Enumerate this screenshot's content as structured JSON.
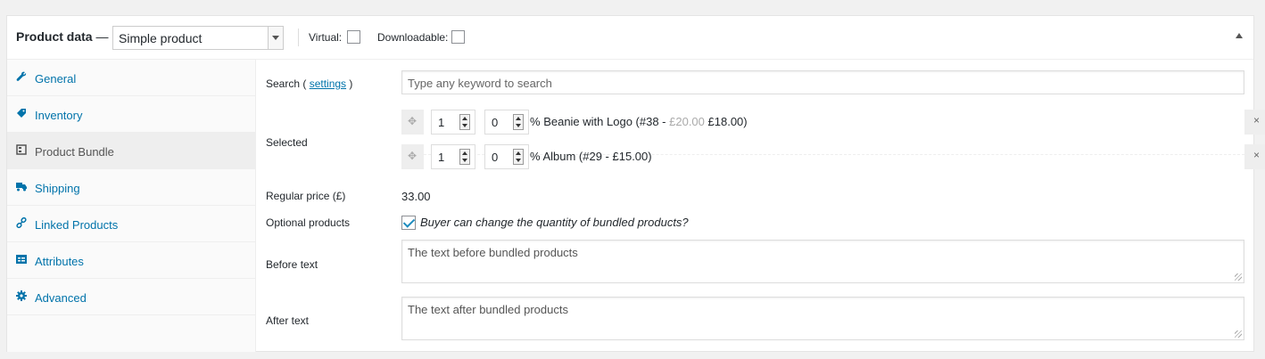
{
  "header": {
    "title": "Product data",
    "dash": "—",
    "product_type": "Simple product",
    "virtual_label": "Virtual:",
    "downloadable_label": "Downloadable:"
  },
  "tabs": [
    {
      "label": "General",
      "icon": "wrench-icon"
    },
    {
      "label": "Inventory",
      "icon": "tag-icon"
    },
    {
      "label": "Product Bundle",
      "icon": "bundle-icon",
      "active": true
    },
    {
      "label": "Shipping",
      "icon": "truck-icon"
    },
    {
      "label": "Linked Products",
      "icon": "link-icon"
    },
    {
      "label": "Attributes",
      "icon": "attributes-icon"
    },
    {
      "label": "Advanced",
      "icon": "gear-icon"
    }
  ],
  "search": {
    "label_prefix": "Search (",
    "settings_link": "settings",
    "label_suffix": ")",
    "placeholder": "Type any keyword to search"
  },
  "selected": {
    "label": "Selected",
    "items": [
      {
        "qty": "1",
        "discount": "0",
        "percent": "%",
        "name": "Beanie with Logo (#38 - ",
        "old_price": "£20.00",
        "price": "£18.00)",
        "drag": "✥",
        "remove": "×"
      },
      {
        "qty": "1",
        "discount": "0",
        "percent": "%",
        "name": "Album (#29 - £15.00)",
        "old_price": "",
        "price": "",
        "drag": "✥",
        "remove": "×"
      }
    ]
  },
  "regular_price": {
    "label": "Regular price (£)",
    "value": "33.00"
  },
  "optional": {
    "label": "Optional products",
    "checked": true,
    "text": "Buyer can change the quantity of bundled products?"
  },
  "before_text": {
    "label": "Before text",
    "value": "The text before bundled products"
  },
  "after_text": {
    "label": "After text",
    "value": "The text after bundled products"
  },
  "colors": {
    "link": "#0073aa",
    "active_tab_bg": "#eeeeee",
    "check": "#1e8cbe"
  }
}
